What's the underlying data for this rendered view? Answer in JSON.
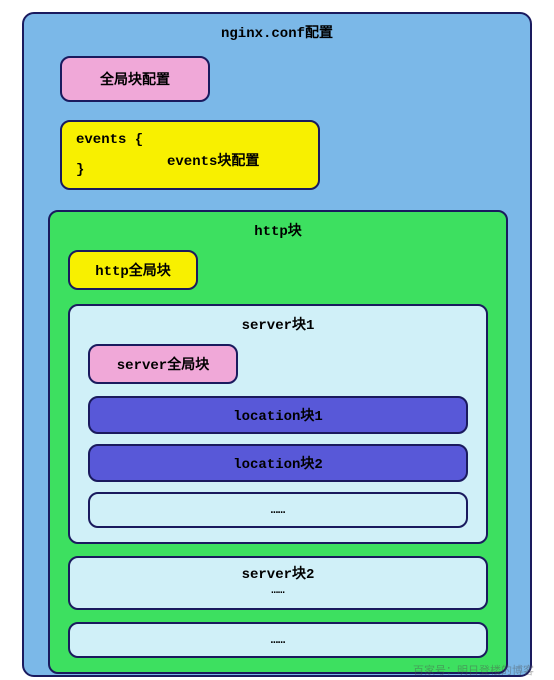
{
  "title": "nginx.conf配置",
  "global": {
    "label": "全局块配置"
  },
  "events": {
    "open": "events {",
    "label": "events块配置",
    "close": "}"
  },
  "http": {
    "title": "http块",
    "global": "http全局块",
    "server1": {
      "title": "server块1",
      "global": "server全局块",
      "location1": "location块1",
      "location2": "location块2",
      "ellipsis": "……"
    },
    "server2": {
      "title": "server块2",
      "dots": "……"
    },
    "ellipsis": "……"
  },
  "watermark": "百家号：明日登楼的博客"
}
